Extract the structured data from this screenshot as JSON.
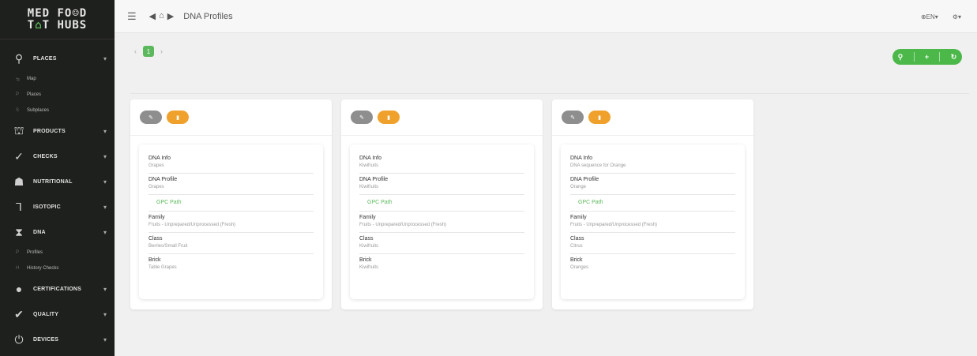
{
  "logo": {
    "line1": "MED FO☺D",
    "line2_a": "T",
    "line2_b": "⌂",
    "line2_c": "T HUBS"
  },
  "topbar": {
    "hamburger": "☰",
    "icon_back": "◀",
    "icon_home": "⌂",
    "icon_forward": "▶",
    "title": "DNA Profiles",
    "lang": "⊕EN▾",
    "settings": "⚙▾"
  },
  "sidebar": {
    "places": {
      "label": "PLACES",
      "icon": "⚲"
    },
    "places_subs": [
      {
        "bullet": "⇆",
        "label": "Map"
      },
      {
        "bullet": "P",
        "label": "Places"
      },
      {
        "bullet": "S",
        "label": "Subplaces"
      }
    ],
    "products": {
      "label": "PRODUCTS",
      "icon": "⛫"
    },
    "checks": {
      "label": "CHECKS",
      "icon": "✓"
    },
    "nutritional": {
      "label": "NUTRITIONAL",
      "icon": "☗"
    },
    "isotopic": {
      "label": "ISOTOPIC",
      "icon": "⅂"
    },
    "dna": {
      "label": "DNA",
      "icon": "⧗"
    },
    "dna_subs": [
      {
        "bullet": "P",
        "label": "Profiles"
      },
      {
        "bullet": "H",
        "label": "History Checks"
      }
    ],
    "certifications": {
      "label": "CERTIFICATIONS",
      "icon": "●"
    },
    "quality": {
      "label": "QUALITY",
      "icon": "✔"
    },
    "devices": {
      "label": "DEVICES",
      "icon": "⏻"
    },
    "chevron": "▾"
  },
  "pager": {
    "prev": "‹",
    "page": "1",
    "next": "›"
  },
  "actions": {
    "search": "⚲",
    "add": "+",
    "refresh": "↻"
  },
  "card_labels": {
    "edit": "✎",
    "delete": "▮",
    "dna_info": "DNA Info",
    "dna_profile": "DNA Profile",
    "gpc_path": "GPC Path",
    "family": "Family",
    "class": "Class",
    "brick": "Brick"
  },
  "cards": [
    {
      "dna_info": "Grapes",
      "dna_profile": "Grapes",
      "family": "Fruits - Unprepared/Unprocessed (Fresh)",
      "class": "Berries/Small Fruit",
      "brick": "Table Grapes"
    },
    {
      "dna_info": "Kiwifruits",
      "dna_profile": "Kiwifruits",
      "family": "Fruits - Unprepared/Unprocessed (Fresh)",
      "class": "Kiwifruits",
      "brick": "Kiwifruits"
    },
    {
      "dna_info": "DNA sequence for Orange",
      "dna_profile": "Orange",
      "family": "Fruits - Unprepared/Unprocessed (Fresh)",
      "class": "Citrus",
      "brick": "Oranges"
    }
  ],
  "colors": {
    "sidebar_bg": "#1e201d",
    "accent_green": "#5cb85c",
    "delete_orange": "#f0a12b",
    "edit_gray": "#8e8e8e"
  }
}
